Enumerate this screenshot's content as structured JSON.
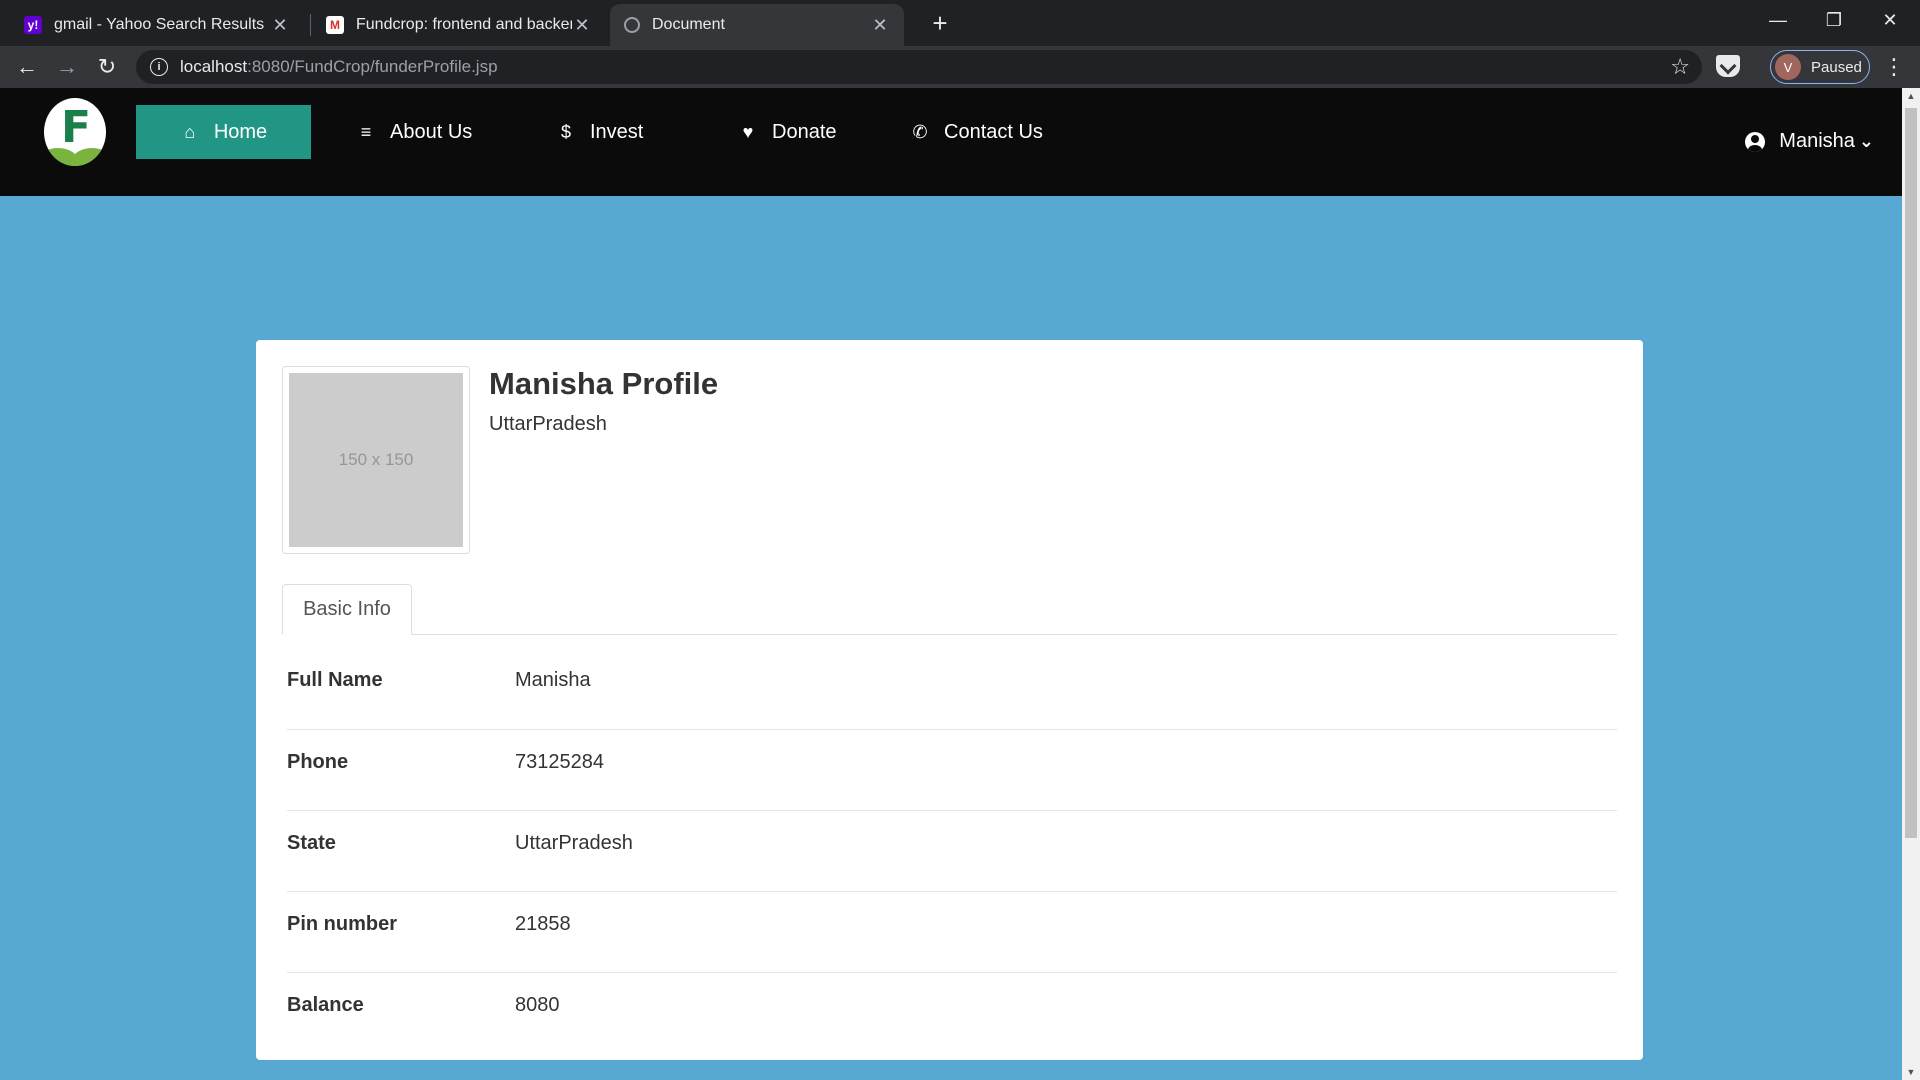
{
  "browser": {
    "tabs": [
      {
        "title": "gmail - Yahoo Search Results",
        "favicon": "yahoo-icon"
      },
      {
        "title": "Fundcrop: frontend and backend",
        "favicon": "gmail-icon"
      },
      {
        "title": "Document",
        "favicon": "globe-icon"
      }
    ],
    "url_host": "localhost",
    "url_rest": ":8080/FundCrop/funderProfile.jsp",
    "profile_initial": "V",
    "profile_status": "Paused"
  },
  "nav": {
    "items": [
      {
        "label": "Home",
        "icon": "home-icon"
      },
      {
        "label": "About Us",
        "icon": "list-icon"
      },
      {
        "label": "Invest",
        "icon": "dollar-icon"
      },
      {
        "label": "Donate",
        "icon": "heart-icon"
      },
      {
        "label": "Contact Us",
        "icon": "phone-icon"
      }
    ],
    "user": "Manisha"
  },
  "profile": {
    "image_placeholder": "150 x 150",
    "title": "Manisha Profile",
    "subtitle": "UttarPradesh",
    "tab": "Basic Info",
    "rows": [
      {
        "label": "Full Name",
        "value": "Manisha"
      },
      {
        "label": "Phone",
        "value": "73125284"
      },
      {
        "label": "State",
        "value": "UttarPradesh"
      },
      {
        "label": "Pin number",
        "value": "21858"
      },
      {
        "label": "Balance",
        "value": "8080"
      }
    ]
  },
  "colors": {
    "page_bg": "#57a9d3",
    "nav_bg": "#0b0b0b",
    "nav_active": "#219684"
  }
}
